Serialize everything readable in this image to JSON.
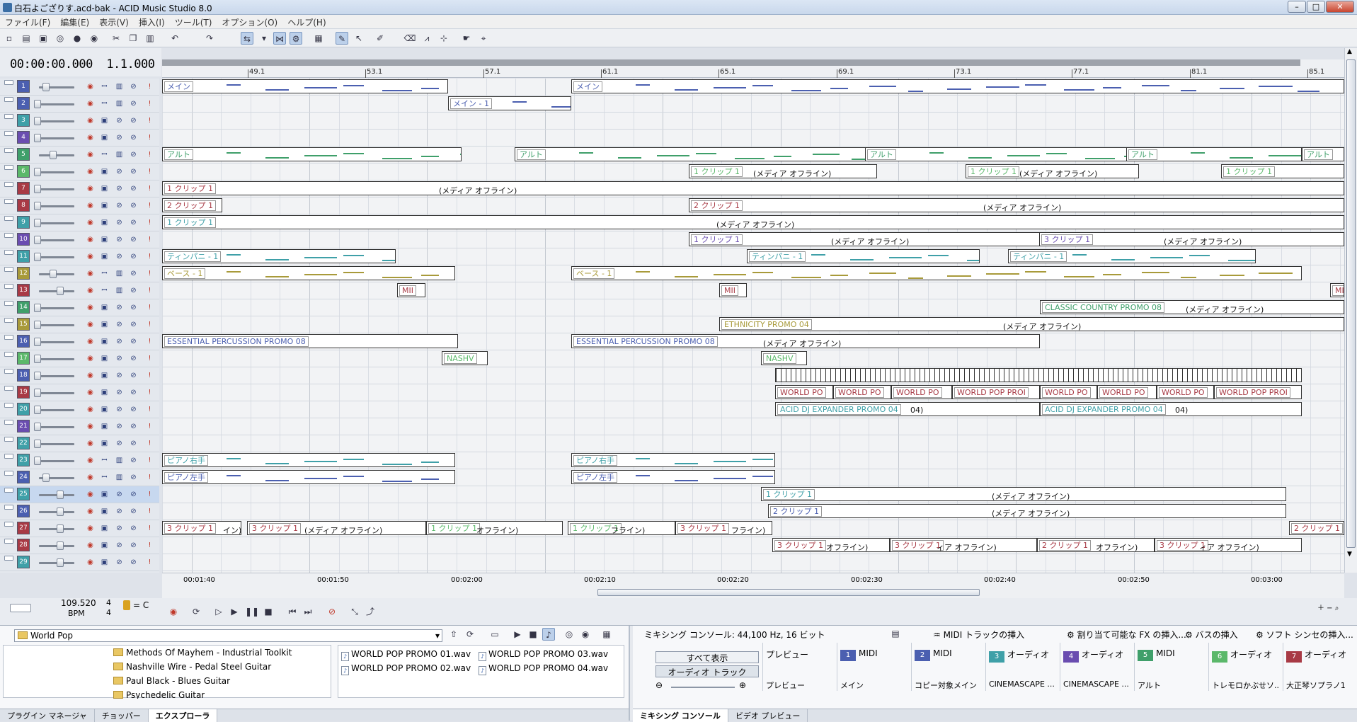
{
  "window": {
    "title": "白石よござりす.acd-bak - ACID Music Studio 8.0"
  },
  "menu": [
    "ファイル(F)",
    "編集(E)",
    "表示(V)",
    "挿入(I)",
    "ツール(T)",
    "オプション(O)",
    "ヘルプ(H)"
  ],
  "time_display": {
    "time": "00:00:00.000",
    "measure": "1.1.000"
  },
  "ruler_marks": [
    "49.1",
    "53.1",
    "57.1",
    "61.1",
    "65.1",
    "69.1",
    "73.1",
    "77.1",
    "81.1",
    "85.1"
  ],
  "time_axis": [
    "00:01:40",
    "00:01:50",
    "00:02:00",
    "00:02:10",
    "00:02:20",
    "00:02:30",
    "00:02:40",
    "00:02:50",
    "00:03:00"
  ],
  "tracks": [
    {
      "n": "1",
      "color": "#4b5fb0"
    },
    {
      "n": "2",
      "color": "#4b5fb0"
    },
    {
      "n": "3",
      "color": "#3fa0a8"
    },
    {
      "n": "4",
      "color": "#6a4db0"
    },
    {
      "n": "5",
      "color": "#3f9f6a"
    },
    {
      "n": "6",
      "color": "#5bb86a"
    },
    {
      "n": "7",
      "color": "#a83a45"
    },
    {
      "n": "8",
      "color": "#a83a45"
    },
    {
      "n": "9",
      "color": "#3fa0a8"
    },
    {
      "n": "10",
      "color": "#6a4db0"
    },
    {
      "n": "11",
      "color": "#3fa0a8"
    },
    {
      "n": "12",
      "color": "#a89a3a"
    },
    {
      "n": "13",
      "color": "#a83a45"
    },
    {
      "n": "14",
      "color": "#3f9f6a"
    },
    {
      "n": "15",
      "color": "#a89a3a"
    },
    {
      "n": "16",
      "color": "#4b5fb0"
    },
    {
      "n": "17",
      "color": "#5bb86a"
    },
    {
      "n": "18",
      "color": "#4b5fb0"
    },
    {
      "n": "19",
      "color": "#a83a45"
    },
    {
      "n": "20",
      "color": "#3fa0a8"
    },
    {
      "n": "21",
      "color": "#6a4db0"
    },
    {
      "n": "22",
      "color": "#3fa0a8"
    },
    {
      "n": "23",
      "color": "#3fa0a8"
    },
    {
      "n": "24",
      "color": "#4b5fb0"
    },
    {
      "n": "25",
      "color": "#3fa0a8"
    },
    {
      "n": "26",
      "color": "#4b5fb0"
    },
    {
      "n": "27",
      "color": "#a83a45"
    },
    {
      "n": "28",
      "color": "#a83a45"
    },
    {
      "n": "29",
      "color": "#3fa0a8"
    }
  ],
  "events": {
    "main": "メイン",
    "main1": "メイン - 1",
    "alto": "アルト",
    "clip1": "1 クリップ 1",
    "clip2": "2 クリップ 1",
    "clip3": "3 クリップ 1",
    "offline": "(メディア オフライン)",
    "timpani": "ティンパニ - 1",
    "bass": "ベース - 1",
    "mii": "MII",
    "country": "CLASSIC COUNTRY PROMO 08",
    "ethnicity": "ETHNICITY PROMO 04",
    "perc": "ESSENTIAL PERCUSSION PROMO 08",
    "nashv": "NASHV",
    "worldpo": "WORLD PO",
    "worldpromo": "WORLD POP PROI",
    "acidx": "ACID DJ EXPANDER PROMO 04",
    "acidx_tail": "04)",
    "piano_r": "ピアノ右手",
    "piano_l": "ピアノ左手",
    "off_tail1": "イン)",
    "off_tail2": "フライン)",
    "off_tail3": "オフライン)",
    "off_tail4": "ィア オフライン)"
  },
  "transport": {
    "bpm": "109.520",
    "bpm_label": "BPM",
    "ts_top": "4",
    "ts_bottom": "4",
    "key": "= C"
  },
  "explorer": {
    "path": "World Pop",
    "folders": [
      "Methods Of Mayhem - Industrial Toolkit",
      "Nashville Wire - Pedal Steel Guitar",
      "Paul Black - Blues Guitar",
      "Psychedelic Guitar"
    ],
    "files": [
      "WORLD POP PROMO 01.wav",
      "WORLD POP PROMO 02.wav",
      "WORLD POP PROMO 03.wav",
      "WORLD POP PROMO 04.wav"
    ],
    "tabs": [
      "プラグイン マネージャ",
      "チョッパー",
      "エクスプローラ"
    ]
  },
  "mixer": {
    "title": "ミキシング コンソール: 44,100 Hz, 16 ビット",
    "actions": [
      "MIDI トラックの挿入",
      "割り当て可能な FX の挿入...",
      "バスの挿入",
      "ソフト シンセの挿入..."
    ],
    "show_all": "すべて表示",
    "audio_tracks": "オーディオ トラック",
    "preview": "プレビュー",
    "columns": [
      {
        "badge": "1",
        "type": "MIDI",
        "name": "メイン",
        "color": "#4b5fb0"
      },
      {
        "badge": "2",
        "type": "MIDI",
        "name": "コピー対象メイン",
        "color": "#4b5fb0"
      },
      {
        "badge": "3",
        "type": "オーディオ",
        "name": "CINEMASCAPE ...",
        "color": "#3fa0a8"
      },
      {
        "badge": "4",
        "type": "オーディオ",
        "name": "CINEMASCAPE ...",
        "color": "#6a4db0"
      },
      {
        "badge": "5",
        "type": "MIDI",
        "name": "アルト",
        "color": "#3f9f6a"
      },
      {
        "badge": "6",
        "type": "オーディオ",
        "name": "トレモロかぶせソ...",
        "color": "#5bb86a"
      },
      {
        "badge": "7",
        "type": "オーディオ",
        "name": "大正琴ソプラノ1",
        "color": "#a83a45"
      }
    ],
    "tabs": [
      "ミキシング コンソール",
      "ビデオ プレビュー"
    ]
  }
}
